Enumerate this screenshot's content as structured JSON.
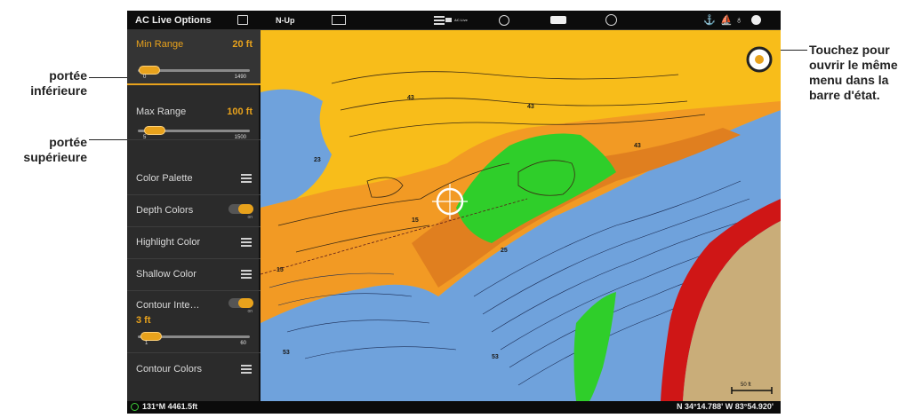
{
  "annotations": {
    "lower_range": "portée inférieure",
    "upper_range": "portée supérieure",
    "touch_hint": "Touchez pour ouvrir le même menu dans la barre d'état."
  },
  "status_bar": {
    "menu_title": "AC Live Options",
    "orientation": "N-Up",
    "ac_live_label": "AC Live",
    "mode_icon": "fishing-hook-icon",
    "gps_icon": "satellite-icon",
    "compass_icon": "compass-icon"
  },
  "menu": {
    "min_range": {
      "label": "Min Range",
      "value": "20 ft",
      "slider_min": "0",
      "slider_max": "1490",
      "level_fraction": 0.01
    },
    "max_range": {
      "label": "Max Range",
      "value": "100 ft",
      "slider_min": "5",
      "slider_max": "1500",
      "level_fraction": 0.07
    },
    "color_palette": {
      "label": "Color Palette"
    },
    "depth_colors": {
      "label": "Depth Colors",
      "toggle": "on"
    },
    "highlight_color": {
      "label": "Highlight Color"
    },
    "shallow_color": {
      "label": "Shallow Color"
    },
    "contour_interval": {
      "label": "Contour Inte…",
      "toggle": "on",
      "value": "3 ft",
      "slider_min": "1",
      "slider_max": "60",
      "level_fraction": 0.03
    },
    "contour_colors": {
      "label": "Contour Colors"
    }
  },
  "map": {
    "depth_labels": [
      "43",
      "43",
      "43",
      "15",
      "15",
      "25",
      "23",
      "53",
      "53"
    ],
    "scale_label": "50 ft",
    "colors": {
      "shallow_yellow": "#f8bd1a",
      "mid_orange": "#f29a24",
      "deep_orange": "#e07f1f",
      "green_highlight": "#2fce2a",
      "water_blue": "#6fa2dc",
      "contour_red": "#cf1616",
      "land_tan": "#c9ad79"
    }
  },
  "bottom_bar": {
    "heading": "131°M  4461.5ft",
    "position": "N 34°14.788' W 83°54.920'"
  }
}
